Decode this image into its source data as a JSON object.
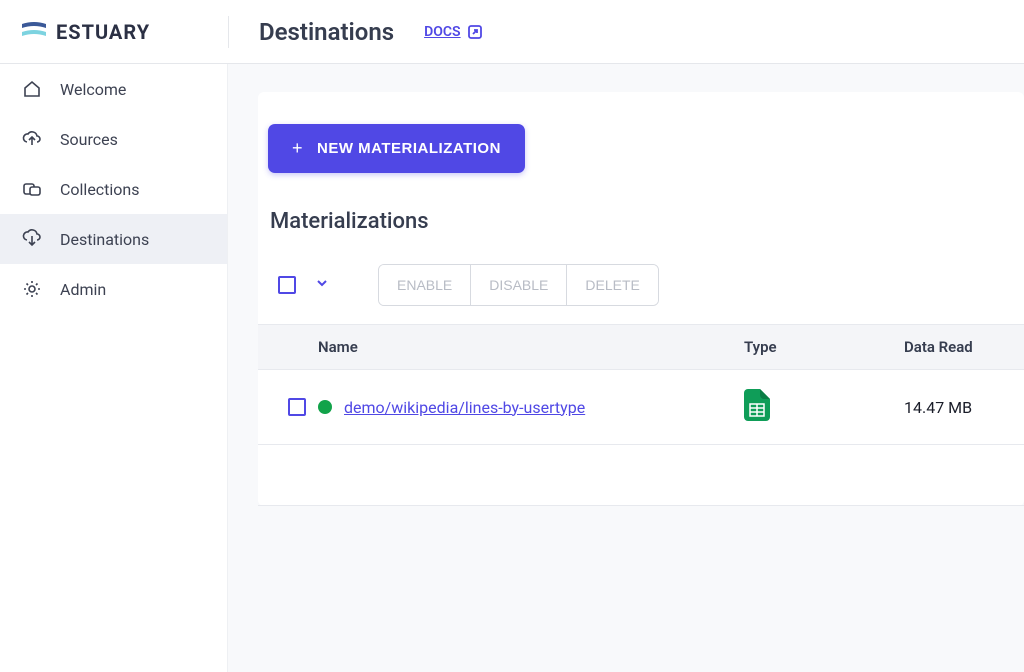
{
  "brand": "ESTUARY",
  "header": {
    "title": "Destinations",
    "docs_label": "DOCS"
  },
  "sidebar": {
    "items": [
      {
        "label": "Welcome"
      },
      {
        "label": "Sources"
      },
      {
        "label": "Collections"
      },
      {
        "label": "Destinations"
      },
      {
        "label": "Admin"
      }
    ]
  },
  "main": {
    "new_button": "NEW MATERIALIZATION",
    "section_title": "Materializations",
    "actions": {
      "enable": "ENABLE",
      "disable": "DISABLE",
      "delete": "DELETE"
    },
    "columns": {
      "name": "Name",
      "type": "Type",
      "data_read": "Data Read"
    },
    "rows": [
      {
        "name": "demo/wikipedia/lines-by-usertype",
        "data_read": "14.47 MB"
      }
    ]
  }
}
